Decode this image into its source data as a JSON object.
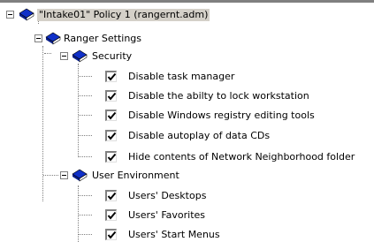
{
  "root": {
    "label": "\"Intake01\" Policy 1 (rangernt.adm)"
  },
  "ranger_settings": {
    "label": "Ranger Settings"
  },
  "security": {
    "label": "Security",
    "items": [
      {
        "label": "Disable task manager",
        "checked": true
      },
      {
        "label": "Disable the abilty to lock workstation",
        "checked": true
      },
      {
        "label": "Disable Windows registry editing tools",
        "checked": true
      },
      {
        "label": "Disable autoplay of data CDs",
        "checked": true
      },
      {
        "label": "Hide contents of Network Neighborhood folder",
        "checked": true
      }
    ]
  },
  "user_environment": {
    "label": "User Environment",
    "items": [
      {
        "label": "Users' Desktops",
        "checked": true
      },
      {
        "label": "Users' Favorites",
        "checked": true
      },
      {
        "label": "Users' Start Menus",
        "checked": true
      }
    ]
  },
  "icons": {
    "expander": "minus-expander-icon",
    "category": "policy-book-icon",
    "checkbox": "checkbox-checked-icon"
  },
  "colors": {
    "book_blue": "#1030c8",
    "book_page": "#ffffff",
    "tree_lines": "#808080",
    "selection": "#d4d0c8"
  }
}
